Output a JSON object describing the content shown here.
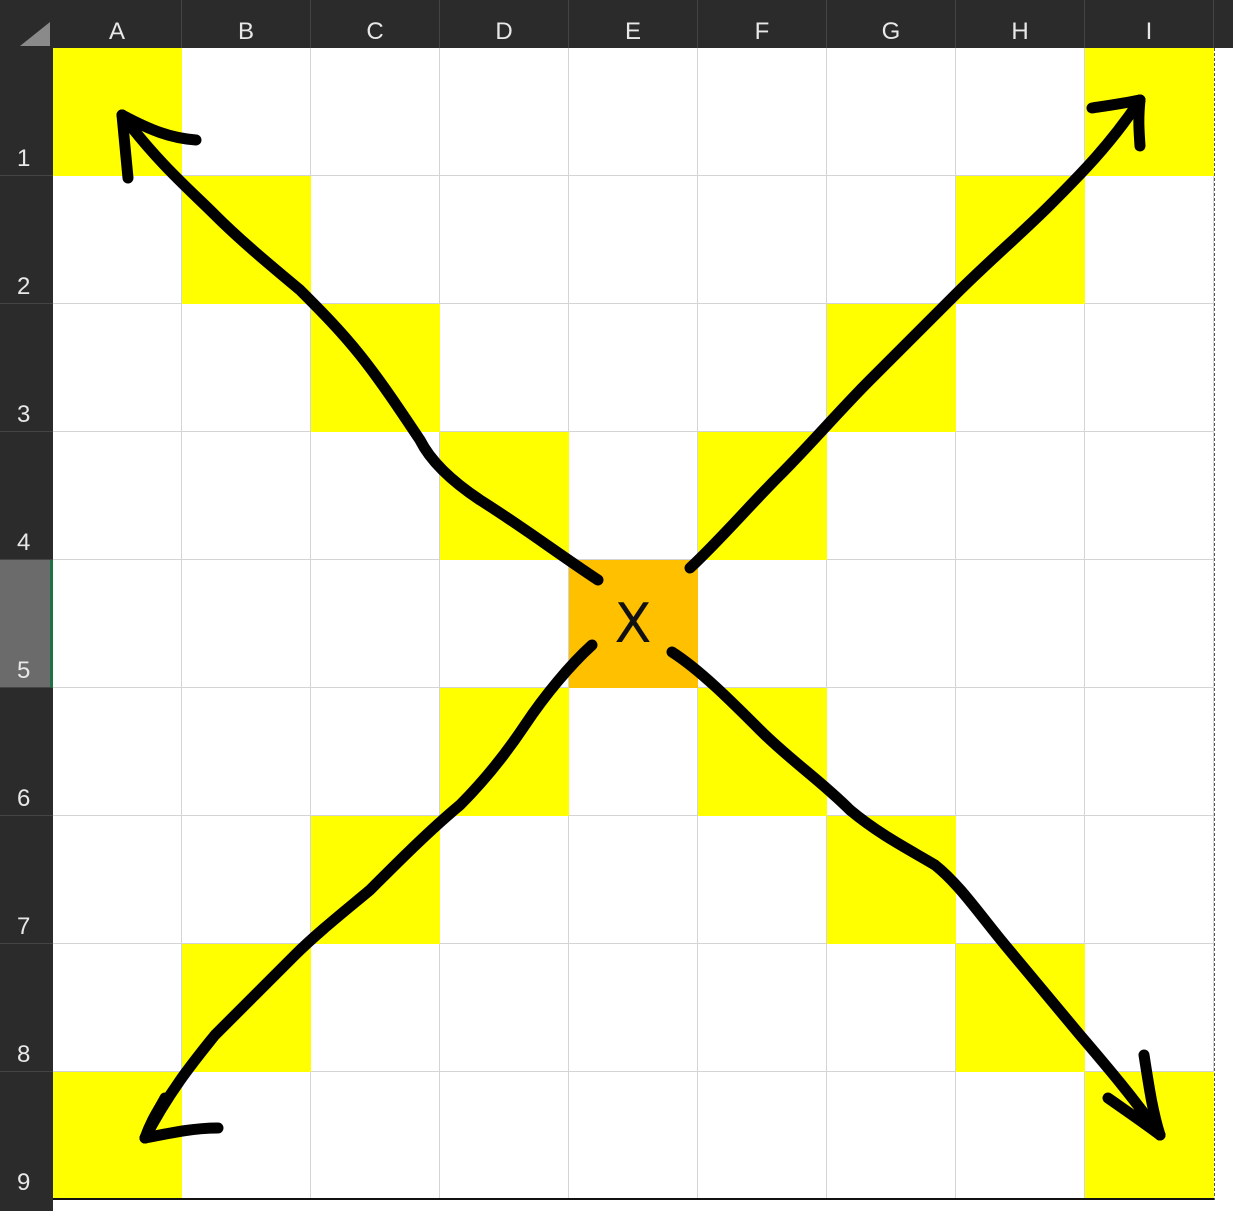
{
  "sheet": {
    "columns": [
      "A",
      "B",
      "C",
      "D",
      "E",
      "F",
      "G",
      "H",
      "I"
    ],
    "rows": [
      "1",
      "2",
      "3",
      "4",
      "5",
      "6",
      "7",
      "8",
      "9"
    ],
    "selected_row": 5,
    "colors": {
      "highlight": "#FFFF00",
      "center": "#FFC000",
      "header_bg": "#2B2B2B",
      "grid": "#D4D4D4"
    },
    "highlighted_cells": [
      "A1",
      "B2",
      "C3",
      "D4",
      "F4",
      "G3",
      "H2",
      "I1",
      "D6",
      "C7",
      "B8",
      "A9",
      "F6",
      "G7",
      "H8",
      "I9"
    ],
    "center_cell": {
      "ref": "E5",
      "value": "X"
    }
  },
  "annotations": {
    "arrows": [
      {
        "name": "arrow-up-left",
        "from": "E5",
        "to": "A1"
      },
      {
        "name": "arrow-up-right",
        "from": "E5",
        "to": "I1"
      },
      {
        "name": "arrow-down-left",
        "from": "E5",
        "to": "A9"
      },
      {
        "name": "arrow-down-right",
        "from": "E5",
        "to": "I9"
      }
    ]
  }
}
